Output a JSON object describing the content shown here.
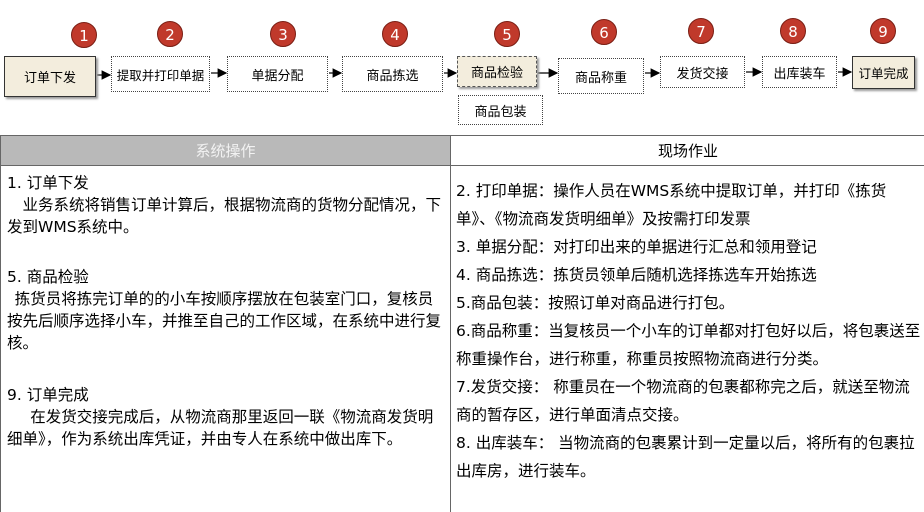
{
  "flow": {
    "steps": [
      {
        "num": "1",
        "label": "订单下发"
      },
      {
        "num": "2",
        "label": "提取并打印单据"
      },
      {
        "num": "3",
        "label": "单据分配"
      },
      {
        "num": "4",
        "label": "商品拣选"
      },
      {
        "num": "5",
        "label": "商品检验",
        "sub_label": "商品包装"
      },
      {
        "num": "6",
        "label": "商品称重"
      },
      {
        "num": "7",
        "label": "发货交接"
      },
      {
        "num": "8",
        "label": "出库装车"
      },
      {
        "num": "9",
        "label": "订单完成"
      }
    ],
    "colors": {
      "badge": "#c0392b",
      "box_fill": "#f3eddd",
      "arrow": "#000000"
    }
  },
  "table": {
    "left_header": "系统操作",
    "right_header": "现场作业",
    "header_fill": "#b9b9b9",
    "left_items": [
      {
        "title": "1. 订单下发",
        "body": "业务系统将销售订单计算后，根据物流商的货物分配情况，下发到WMS系统中。"
      },
      {
        "title": "5. 商品检验",
        "body": "拣货员将拣完订单的的小车按顺序摆放在包装室门口，复核员按先后顺序选择小车，并推至自己的工作区域，在系统中进行复核。"
      },
      {
        "title": "9. 订单完成",
        "body": "在发货交接完成后，从物流商那里返回一联《物流商发货明细单》，作为系统出库凭证，并由专人在系统中做出库下。"
      }
    ],
    "right_items": [
      "2. 打印单据：操作人员在WMS系统中提取订单，并打印《拣货单》、《物流商发货明细单》及按需打印发票",
      "3. 单据分配：对打印出来的单据进行汇总和领用登记",
      "4. 商品拣选：拣货员领单后随机选择拣选车开始拣选",
      "5.商品包装：按照订单对商品进行打包。",
      "6.商品称重：当复核员一个小车的订单都对打包好以后，将包裹送至称重操作台，进行称重，称重员按照物流商进行分类。",
      "7.发货交接： 称重员在一个物流商的包裹都称完之后，就送至物流商的暂存区，进行单面清点交接。",
      "8. 出库装车： 当物流商的包裹累计到一定量以后，将所有的包裹拉出库房，进行装车。"
    ]
  }
}
